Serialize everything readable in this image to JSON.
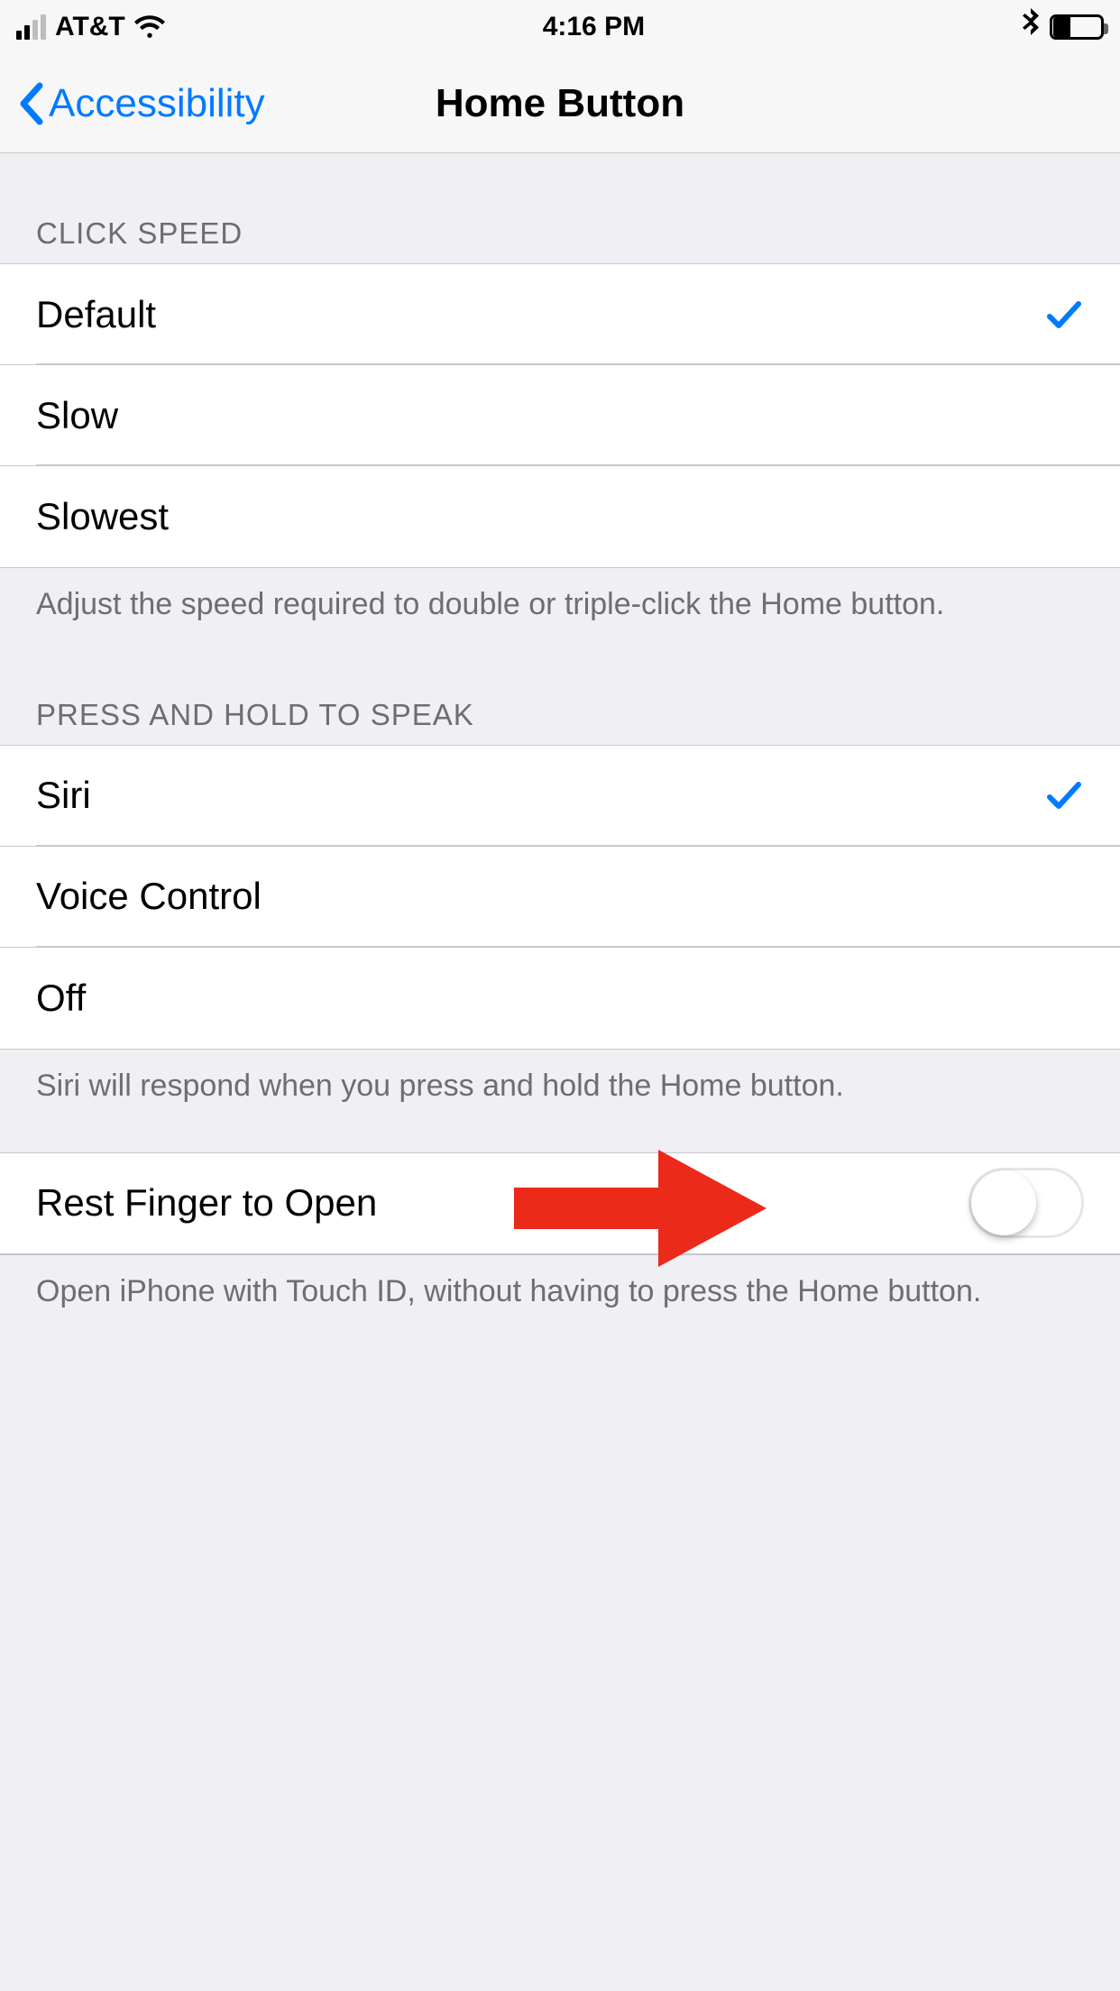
{
  "status": {
    "carrier": "AT&T",
    "time": "4:16 PM"
  },
  "nav": {
    "back_label": "Accessibility",
    "title": "Home Button"
  },
  "sections": {
    "click_speed": {
      "header": "Click Speed",
      "options": {
        "default": "Default",
        "slow": "Slow",
        "slowest": "Slowest"
      },
      "selected": "default",
      "footer": "Adjust the speed required to double or triple-click the Home button."
    },
    "press_hold": {
      "header": "Press and Hold to Speak",
      "options": {
        "siri": "Siri",
        "voice_control": "Voice Control",
        "off": "Off"
      },
      "selected": "siri",
      "footer": "Siri will respond when you press and hold the Home button."
    },
    "rest_finger": {
      "label": "Rest Finger to Open",
      "value": false,
      "footer": "Open iPhone with Touch ID, without having to press the Home button."
    }
  }
}
